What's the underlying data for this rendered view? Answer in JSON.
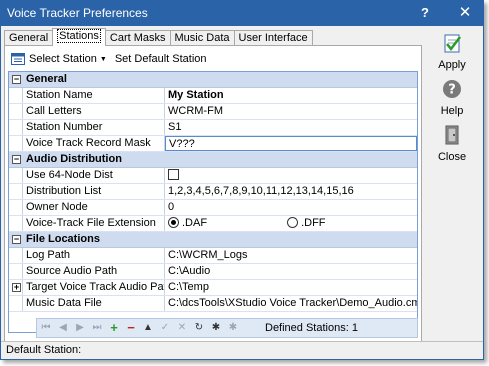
{
  "window": {
    "title": "Voice Tracker Preferences",
    "help_glyph": "?",
    "close_glyph": "✕"
  },
  "tabs": [
    {
      "label": "General",
      "active": false
    },
    {
      "label": "Stations",
      "active": true
    },
    {
      "label": "Cart Masks",
      "active": false
    },
    {
      "label": "Music Data",
      "active": false
    },
    {
      "label": "User Interface",
      "active": false
    }
  ],
  "toolbar": {
    "select_station_label": "Select Station",
    "set_default_label": "Set Default Station"
  },
  "grid": {
    "general": {
      "category": "General",
      "station_name": {
        "label": "Station Name",
        "value": "My Station"
      },
      "call_letters": {
        "label": "Call Letters",
        "value": "WCRM-FM"
      },
      "station_number": {
        "label": "Station Number",
        "value": "S1"
      },
      "record_mask": {
        "label": "Voice Track Record Mask",
        "value": "V???"
      }
    },
    "audio": {
      "category": "Audio Distribution",
      "use_64": {
        "label": "Use 64-Node Dist",
        "checked": false
      },
      "dist_list": {
        "label": "Distribution List",
        "value": "1,2,3,4,5,6,7,8,9,10,11,12,13,14,15,16"
      },
      "owner_node": {
        "label": "Owner Node",
        "value": "0"
      },
      "file_ext": {
        "label": "Voice-Track File Extension",
        "option_a": ".DAF",
        "option_b": ".DFF",
        "selected": ".DAF"
      }
    },
    "files": {
      "category": "File Locations",
      "log_path": {
        "label": "Log Path",
        "value": "C:\\WCRM_Logs"
      },
      "source_audio": {
        "label": "Source Audio Path",
        "value": "C:\\Audio"
      },
      "target_audio": {
        "label": "Target Voice Track Audio Path",
        "value": "C:\\Temp"
      },
      "music_data": {
        "label": "Music Data File",
        "value": "C:\\dcsTools\\XStudio Voice Tracker\\Demo_Audio.cmr"
      }
    },
    "expand_minus": "−",
    "expand_plus": "+"
  },
  "navigator": {
    "first": "⏮",
    "prev": "◀",
    "next": "▶",
    "last": "⏭",
    "add": "+",
    "delete": "−",
    "up": "▲",
    "post": "✓",
    "cancel": "✕",
    "refresh": "↻",
    "star1": "✱",
    "star2": "✱",
    "defined_stations": "Defined Stations: 1"
  },
  "buttons": {
    "apply": "Apply",
    "help": "Help",
    "close": "Close"
  },
  "status": {
    "default_station": "Default Station:"
  },
  "colors": {
    "titlebar": "#2a63a8",
    "category_band": "#cfdcef",
    "navigator_bg": "#dfe8f5"
  }
}
